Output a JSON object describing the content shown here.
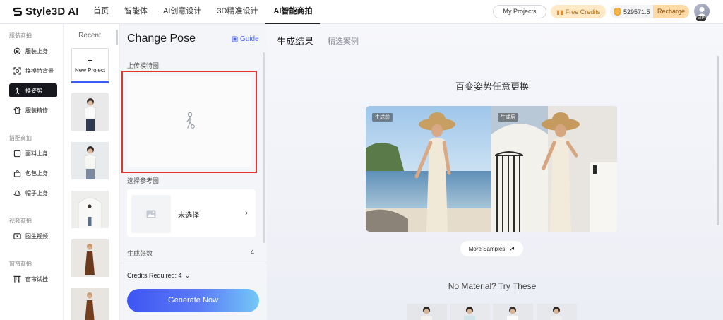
{
  "brand": {
    "name": "Style3D AI"
  },
  "nav": [
    {
      "label": "首页",
      "active": false
    },
    {
      "label": "智能体",
      "active": false
    },
    {
      "label": "AI创意设计",
      "active": false
    },
    {
      "label": "3D精准设计",
      "active": false
    },
    {
      "label": "AI智能商拍",
      "active": true
    }
  ],
  "header": {
    "my_projects": "My Projects",
    "free_credits": "Free Credits",
    "balance": "529571.5",
    "recharge": "Recharge",
    "vip": "VIP"
  },
  "sidebar": {
    "sections": [
      {
        "title": "服装商拍",
        "items": [
          {
            "label": "服装上身",
            "icon": "tshirt-icon",
            "active": false
          },
          {
            "label": "换模特背景",
            "icon": "face-scan-icon",
            "active": false
          },
          {
            "label": "换姿势",
            "icon": "pose-icon",
            "active": true
          },
          {
            "label": "服装精修",
            "icon": "garment-retouch-icon",
            "active": false
          }
        ]
      },
      {
        "title": "搭配商拍",
        "items": [
          {
            "label": "面料上身",
            "icon": "fabric-icon",
            "active": false
          },
          {
            "label": "包包上身",
            "icon": "bag-icon",
            "active": false
          },
          {
            "label": "帽子上身",
            "icon": "hat-icon",
            "active": false
          }
        ]
      },
      {
        "title": "视频商拍",
        "items": [
          {
            "label": "图生视频",
            "icon": "video-icon",
            "active": false
          }
        ]
      },
      {
        "title": "窗帘商拍",
        "items": [
          {
            "label": "窗帘试挂",
            "icon": "curtain-icon",
            "active": false
          }
        ]
      }
    ]
  },
  "recent": {
    "title": "Recent",
    "new_project": "New Project"
  },
  "panel": {
    "title": "Change Pose",
    "guide": "Guide",
    "upload_label": "上传模特图",
    "reference_label": "选择参考图",
    "reference_placeholder": "未选择",
    "count_label": "生成张数",
    "count_value": "4",
    "credits_required": "Credits Required: 4",
    "generate": "Generate Now"
  },
  "main": {
    "tabs": [
      {
        "label": "生成结果",
        "active": true
      },
      {
        "label": "精选案例",
        "active": false
      }
    ],
    "headline": "百变姿势任意更换",
    "before_tag": "生成前",
    "after_tag": "生成后",
    "more_samples": "More Samples",
    "no_material": "No Material? Try These"
  },
  "colors": {
    "accent": "#3b5cf5",
    "highlight_border": "#e3342f",
    "credits_bg": "#ffe9c7"
  }
}
